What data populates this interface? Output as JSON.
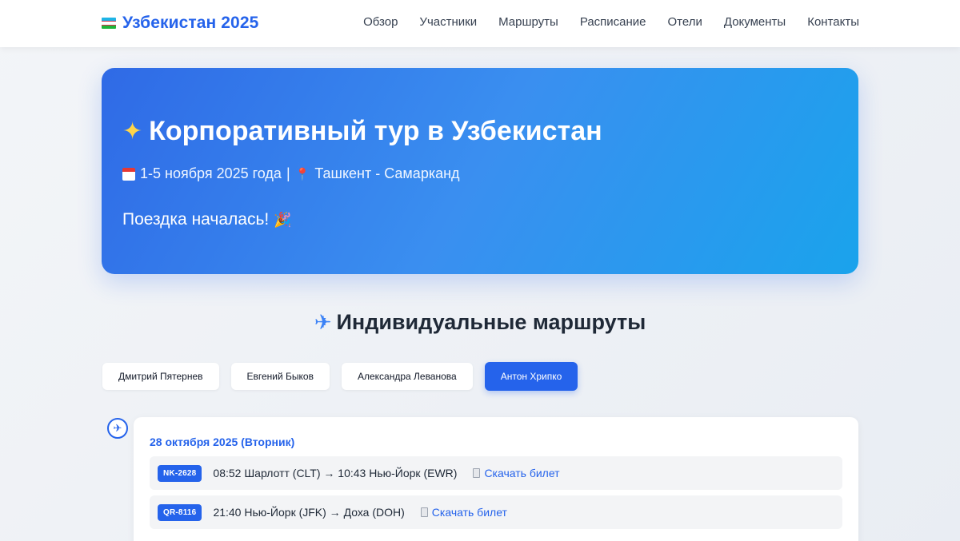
{
  "header": {
    "brand": "Узбекистан 2025",
    "nav": [
      "Обзор",
      "Участники",
      "Маршруты",
      "Расписание",
      "Отели",
      "Документы",
      "Контакты"
    ]
  },
  "hero": {
    "title": "Корпоративный тур в Узбекистан",
    "dates": "1-5 ноября 2025 года",
    "separator": "|",
    "location": "Ташкент - Самарканд",
    "status": "Поездка началась!"
  },
  "routes": {
    "title": "Индивидуальные маршруты",
    "tabs": [
      "Дмитрий Пятернев",
      "Евгений Быков",
      "Александра Леванова",
      "Антон Хрипко"
    ],
    "active_tab": "Антон Хрипко",
    "day": {
      "title": "28 октября 2025 (Вторник)",
      "flights": [
        {
          "code": "NK-2628",
          "route": "08:52 Шарлотт (CLT) → 10:43 Нью-Йорк (EWR)",
          "download": "Скачать билет"
        },
        {
          "code": "QR-8116",
          "route": "21:40 Нью-Йорк (JFK) → Доха (DOH)",
          "download": "Скачать билет"
        }
      ]
    }
  },
  "colors": {
    "accent": "#2563eb",
    "hero_start": "#2f6ae6",
    "hero_end": "#1aa3ec"
  }
}
